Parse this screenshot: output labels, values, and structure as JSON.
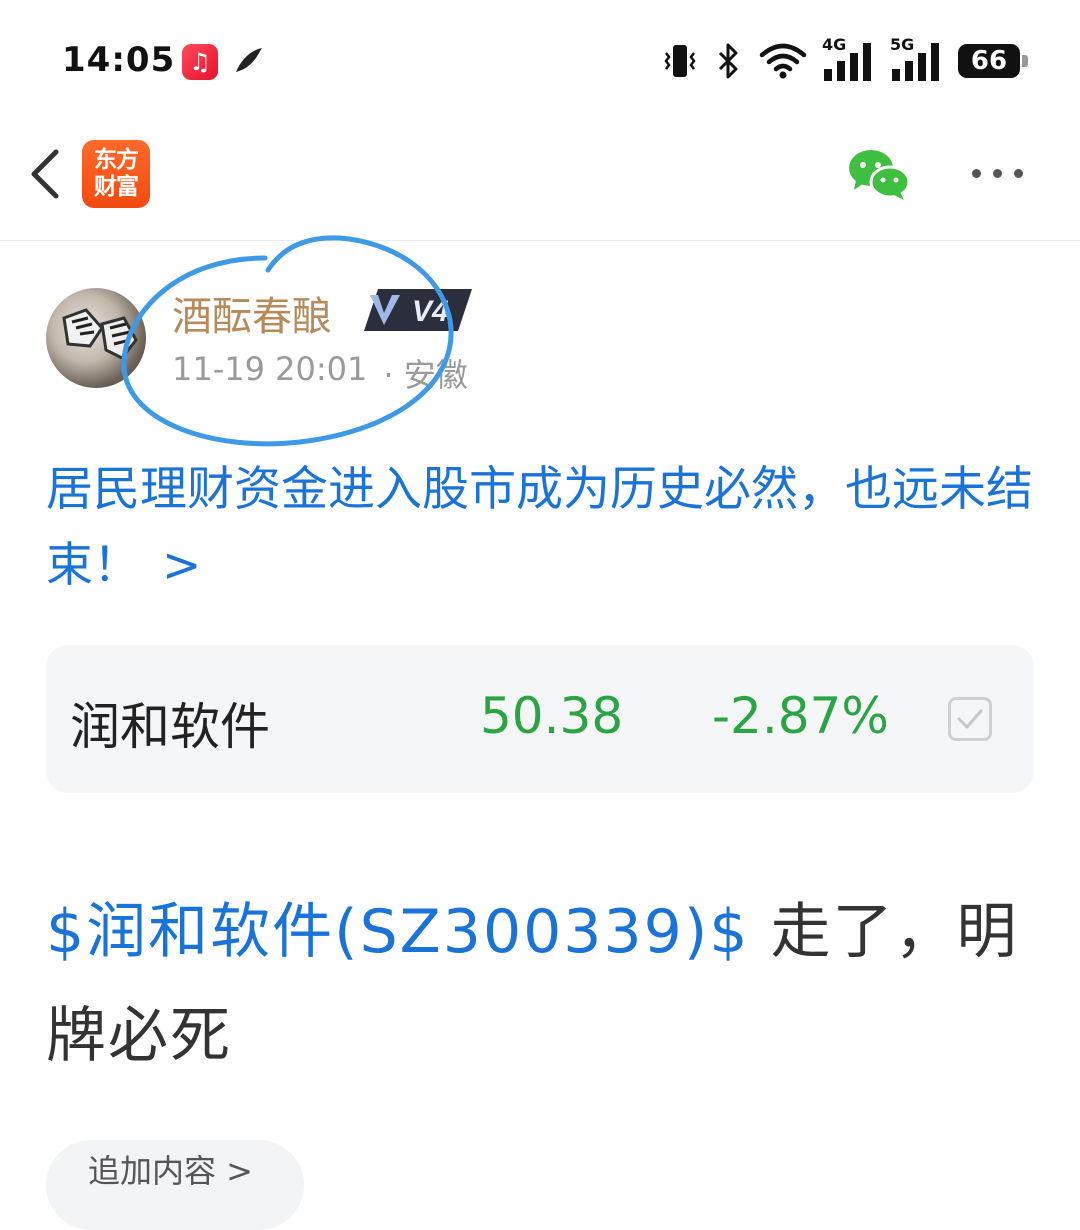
{
  "status_bar": {
    "time": "14:05",
    "icons": [
      "music-app-icon",
      "feather-app-icon",
      "vibrate-icon",
      "bluetooth-icon",
      "wifi-icon",
      "signal-4g-icon",
      "signal-5g-icon"
    ],
    "signal_labels": {
      "first": "4G",
      "second": "5G"
    },
    "battery": "66"
  },
  "nav": {
    "logo_line1": "东方",
    "logo_line2": "财富",
    "icons": [
      "back-icon",
      "wechat-icon",
      "more-icon"
    ]
  },
  "post": {
    "username": "酒酝春酿",
    "level_badge": "V4",
    "timestamp": "11-19 20:01",
    "location": "· 安徽",
    "headline": "居民理财资金进入股市成为历史必然，也远未结束！",
    "headline_arrow": ">",
    "stock_tag": "$润和软件(SZ300339)$",
    "body_text": " 走了，明牌必死",
    "add_content_label": "追加内容 >"
  },
  "stock_card": {
    "name": "润和软件",
    "price": "50.38",
    "change": "-2.87%",
    "change_color": "#2aa543"
  },
  "colors": {
    "link": "#1a73d9",
    "username": "#b78a5a",
    "annotation_circle": "#3e9ae6",
    "brand_orange": "#f24a10"
  }
}
